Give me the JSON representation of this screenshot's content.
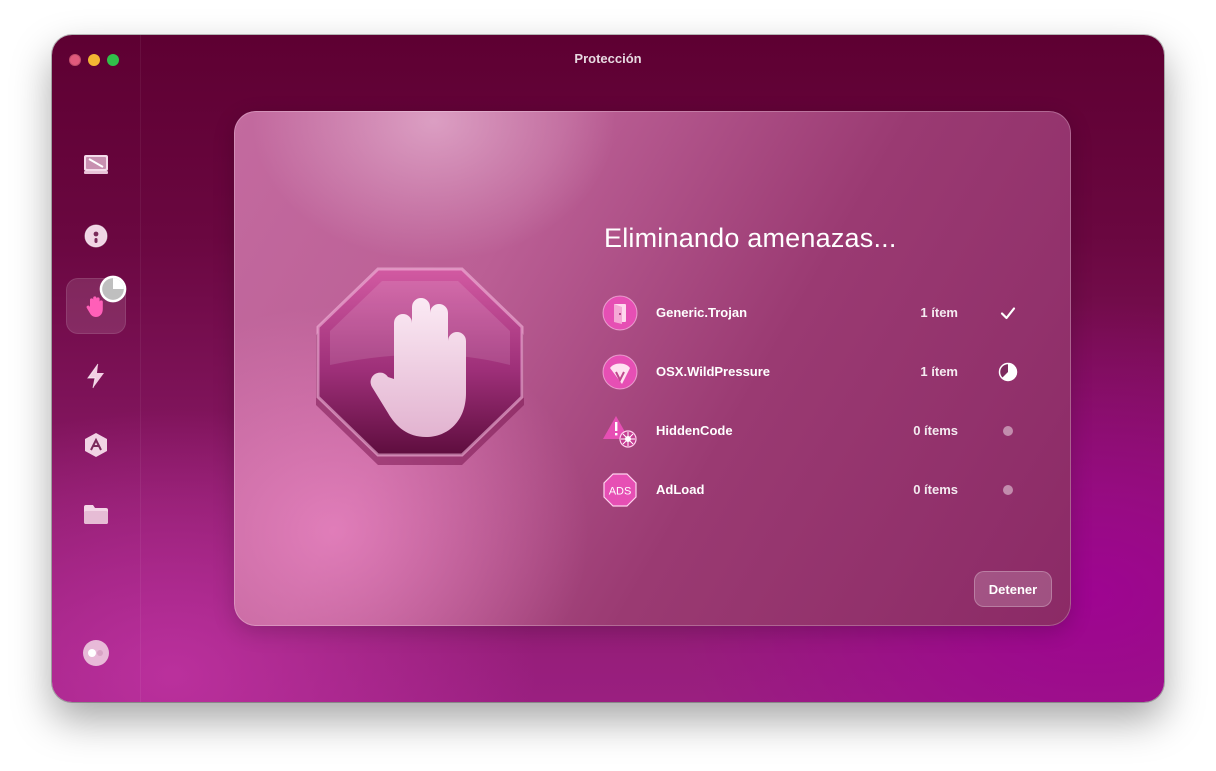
{
  "window": {
    "title": "Protección"
  },
  "sidebar": {
    "items": [
      {
        "name": "cleanup",
        "icon": "monitor-icon"
      },
      {
        "name": "speed",
        "icon": "disk-icon"
      },
      {
        "name": "protection",
        "icon": "hand-icon",
        "active": true
      },
      {
        "name": "performance",
        "icon": "lightning-icon"
      },
      {
        "name": "applications",
        "icon": "apps-icon"
      },
      {
        "name": "files",
        "icon": "folder-icon"
      }
    ],
    "bottom_icon": "assistant-icon"
  },
  "main": {
    "heading": "Eliminando amenazas...",
    "threats": [
      {
        "name": "Generic.Trojan",
        "count": "1 ítem",
        "status": "done",
        "icon": "trojan-door-icon"
      },
      {
        "name": "OSX.WildPressure",
        "count": "1 ítem",
        "status": "in-progress",
        "icon": "wildpressure-icon"
      },
      {
        "name": "HiddenCode",
        "count": "0 ítems",
        "status": "pending",
        "icon": "hiddencode-warning-icon"
      },
      {
        "name": "AdLoad",
        "count": "0 ítems",
        "status": "pending",
        "icon": "ads-icon",
        "icon_text": "ADS"
      }
    ],
    "stop_button": "Detener"
  },
  "colors": {
    "accent": "#e64fb4",
    "window_bg_top": "#5e0032",
    "window_bg_bottom": "#9a1f80"
  }
}
